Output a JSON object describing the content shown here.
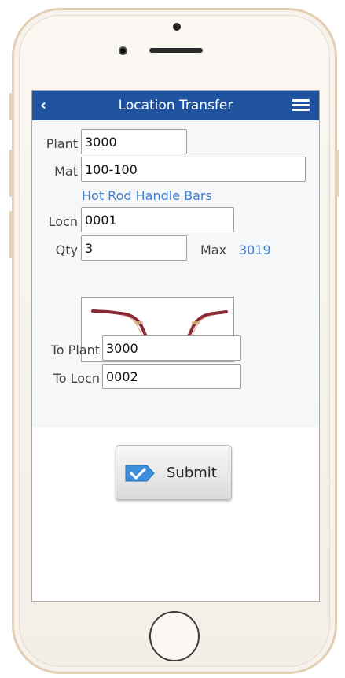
{
  "header": {
    "title": "Location Transfer",
    "back_icon": "chevron-left-icon",
    "menu_icon": "hamburger-menu-icon"
  },
  "form": {
    "plant": {
      "label": "Plant",
      "value": "3000"
    },
    "mat": {
      "label": "Mat",
      "value": "100-100",
      "description": "Hot Rod Handle Bars"
    },
    "locn": {
      "label": "Locn",
      "value": "0001"
    },
    "qty": {
      "label": "Qty",
      "value": "3",
      "max_label": "Max",
      "max_value": "3019"
    },
    "to_plant": {
      "label": "To Plant",
      "value": "3000"
    },
    "to_locn": {
      "label": "To Locn",
      "value": "0002"
    }
  },
  "actions": {
    "submit_label": "Submit",
    "submit_icon": "checkmark-tag-icon"
  },
  "colors": {
    "appbar": "#1f53a0",
    "link": "#3d7fd0",
    "submit_icon": "#3d8fdc"
  }
}
